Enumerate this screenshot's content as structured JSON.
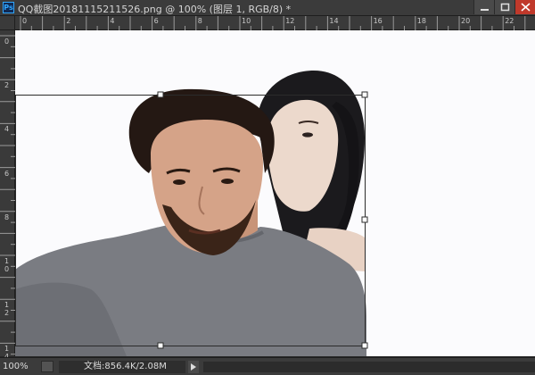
{
  "window": {
    "app_icon_text": "Ps",
    "title": "QQ截图20181115211526.png @ 100% (图层 1, RGB/8) *"
  },
  "rulers": {
    "top_labels": [
      "0",
      "2",
      "4",
      "6",
      "8",
      "10",
      "12",
      "14",
      "16",
      "18",
      "20",
      "22"
    ],
    "left_labels": [
      "0",
      "2",
      "4",
      "6",
      "8",
      "1\n0",
      "1\n2",
      "1\n4"
    ]
  },
  "status": {
    "zoom": "100%",
    "doc_info": "文档:856.4K/2.08M"
  }
}
